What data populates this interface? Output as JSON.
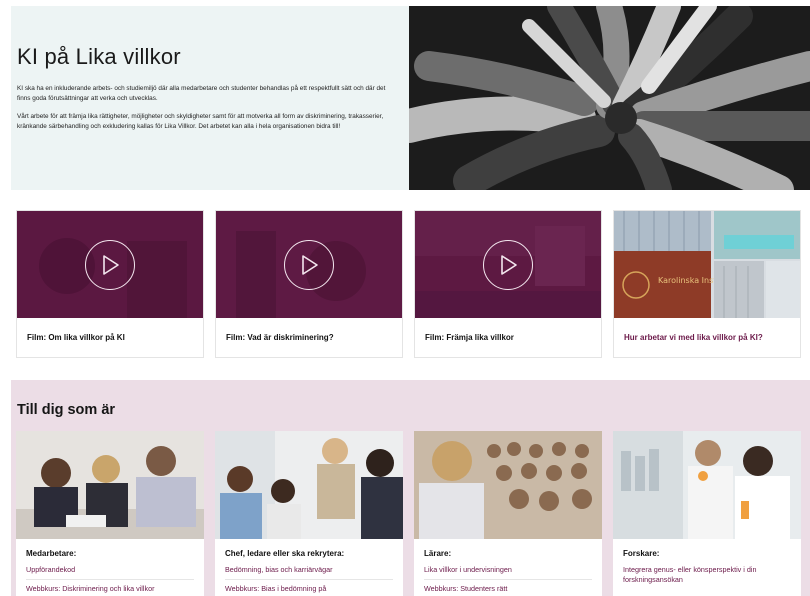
{
  "hero": {
    "title": "KI på Lika villkor",
    "paragraph1": "KI ska ha en inkluderande arbets- och studiemiljö där alla medarbetare och studenter behandlas på ett respektfullt sätt och där det finns goda förutsättningar att verka och utvecklas.",
    "paragraph2": "Vårt arbete för att främja lika rättigheter, möjligheter och skyldigheter samt för att motverka all form av diskriminering, trakasserier, kränkande särbehandling och exkludering kallas för Lika Villkor. Det arbetet kan alla i hela organisationen bidra till!"
  },
  "video_cards": [
    {
      "label": "Film: Om lika villkor på KI",
      "icon": "play-icon"
    },
    {
      "label": "Film: Vad är diskriminering?",
      "icon": "play-icon"
    },
    {
      "label": "Film: Främja lika villkor",
      "icon": "play-icon"
    }
  ],
  "info_card": {
    "label": "Hur arbetar vi med lika villkor på KI?",
    "sign_text": "Karolinska Institutet"
  },
  "audience_section": {
    "title": "Till dig som är",
    "cards": [
      {
        "title": "Medarbetare:",
        "links": [
          "Uppförandekod",
          "Webbkurs: Diskriminering och lika villkor"
        ]
      },
      {
        "title": "Chef, ledare eller ska rekrytera:",
        "links": [
          "Bedömning, bias och karriärvägar",
          "Webbkurs: Bias i bedömning på"
        ]
      },
      {
        "title": "Lärare:",
        "links": [
          "Lika villkor i undervisningen",
          "Webbkurs: Studenters rätt"
        ]
      },
      {
        "title": "Forskare:",
        "links": [
          "Integrera genus- eller könsperspektiv i din forskningsansökan"
        ]
      }
    ]
  },
  "colors": {
    "accent": "#6c1a4a",
    "video_overlay": "#5a1740",
    "hero_bg": "#edf4f4",
    "band_bg": "#ecdde6"
  }
}
